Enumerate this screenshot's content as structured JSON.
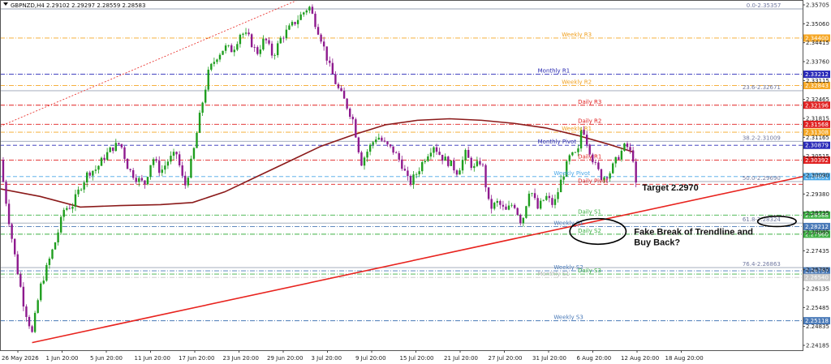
{
  "header": {
    "symbol": "GBPNZD,H4",
    "ohlc": "2.29102 2.29297 2.28559 2.28583"
  },
  "colors": {
    "bull": "#1f9e1f",
    "bear": "#8e1a8e",
    "ma": "#8b1a1a",
    "trend": "#e8231e"
  },
  "chart_data": {
    "type": "line",
    "ylim": [
      2.2415,
      2.3565
    ],
    "y_ticks": [
      "2.35705",
      "2.35060",
      "2.34415",
      "2.33760",
      "2.33115",
      "2.32465",
      "2.31815",
      "2.31165",
      "2.30515",
      "2.30090",
      "2.29380",
      "2.28735",
      "2.28085",
      "2.27435",
      "2.26785",
      "2.26135",
      "2.25485",
      "2.24835",
      "2.24185"
    ],
    "x_ticks": [
      "26 May 2026",
      "1 Jun 20:00",
      "5 Jun 20:00",
      "11 Jun 20:00",
      "17 Jun 20:00",
      "23 Jun 20:00",
      "29 Jun 20:00",
      "3 Jul 20:00",
      "9 Jul 20:00",
      "15 Jul 20:00",
      "21 Jul 20:00",
      "27 Jul 20:00",
      "31 Jul 20:00",
      "6 Aug 20:00",
      "12 Aug 20:00",
      "18 Aug 20:00"
    ],
    "price_path": [
      [
        0,
        2.304
      ],
      [
        0.01,
        2.286
      ],
      [
        0.02,
        2.27
      ],
      [
        0.03,
        2.256
      ],
      [
        0.04,
        2.247
      ],
      [
        0.05,
        2.262
      ],
      [
        0.06,
        2.27
      ],
      [
        0.07,
        2.278
      ],
      [
        0.08,
        2.288
      ],
      [
        0.09,
        2.289
      ],
      [
        0.1,
        2.295
      ],
      [
        0.11,
        2.3
      ],
      [
        0.12,
        2.301
      ],
      [
        0.13,
        2.305
      ],
      [
        0.14,
        2.308
      ],
      [
        0.15,
        2.3095
      ],
      [
        0.16,
        2.301
      ],
      [
        0.17,
        2.298
      ],
      [
        0.18,
        2.296
      ],
      [
        0.19,
        2.305
      ],
      [
        0.2,
        2.3
      ],
      [
        0.21,
        2.304
      ],
      [
        0.22,
        2.306
      ],
      [
        0.23,
        2.295
      ],
      [
        0.24,
        2.305
      ],
      [
        0.25,
        2.32
      ],
      [
        0.26,
        2.333
      ],
      [
        0.27,
        2.338
      ],
      [
        0.28,
        2.341
      ],
      [
        0.29,
        2.34
      ],
      [
        0.3,
        2.346
      ],
      [
        0.31,
        2.344
      ],
      [
        0.32,
        2.339
      ],
      [
        0.33,
        2.344
      ],
      [
        0.34,
        2.338
      ],
      [
        0.35,
        2.344
      ],
      [
        0.36,
        2.347
      ],
      [
        0.37,
        2.35
      ],
      [
        0.38,
        2.353
      ],
      [
        0.385,
        2.3545
      ],
      [
        0.39,
        2.351
      ],
      [
        0.4,
        2.344
      ],
      [
        0.41,
        2.335
      ],
      [
        0.42,
        2.328
      ],
      [
        0.43,
        2.323
      ],
      [
        0.44,
        2.317
      ],
      [
        0.45,
        2.303
      ],
      [
        0.46,
        2.308
      ],
      [
        0.47,
        2.312
      ],
      [
        0.48,
        2.309
      ],
      [
        0.49,
        2.307
      ],
      [
        0.5,
        2.303
      ],
      [
        0.51,
        2.296
      ],
      [
        0.52,
        2.3
      ],
      [
        0.53,
        2.305
      ],
      [
        0.54,
        2.309
      ],
      [
        0.55,
        2.305
      ],
      [
        0.56,
        2.303
      ],
      [
        0.57,
        2.3
      ],
      [
        0.58,
        2.306
      ],
      [
        0.59,
        2.301
      ],
      [
        0.6,
        2.304
      ],
      [
        0.61,
        2.288
      ],
      [
        0.62,
        2.29
      ],
      [
        0.63,
        2.287
      ],
      [
        0.64,
        2.29
      ],
      [
        0.65,
        2.283
      ],
      [
        0.66,
        2.295
      ],
      [
        0.67,
        2.288
      ],
      [
        0.68,
        2.292
      ],
      [
        0.69,
        2.289
      ],
      [
        0.7,
        2.298
      ],
      [
        0.71,
        2.305
      ],
      [
        0.72,
        2.306
      ],
      [
        0.725,
        2.316
      ],
      [
        0.73,
        2.311
      ],
      [
        0.74,
        2.303
      ],
      [
        0.75,
        2.298
      ],
      [
        0.76,
        2.3
      ],
      [
        0.77,
        2.305
      ],
      [
        0.78,
        2.309
      ],
      [
        0.79,
        2.304
      ],
      [
        0.795,
        2.286
      ]
    ],
    "ma_path": [
      [
        0,
        2.2945
      ],
      [
        0.05,
        2.292
      ],
      [
        0.1,
        2.2885
      ],
      [
        0.15,
        2.289
      ],
      [
        0.2,
        2.2893
      ],
      [
        0.24,
        2.29
      ],
      [
        0.28,
        2.2935
      ],
      [
        0.32,
        2.2985
      ],
      [
        0.36,
        2.3035
      ],
      [
        0.4,
        2.3085
      ],
      [
        0.44,
        2.3122
      ],
      [
        0.48,
        2.3155
      ],
      [
        0.52,
        2.317
      ],
      [
        0.56,
        2.3175
      ],
      [
        0.6,
        2.317
      ],
      [
        0.64,
        2.316
      ],
      [
        0.68,
        2.3145
      ],
      [
        0.72,
        2.312
      ],
      [
        0.76,
        2.309
      ],
      [
        0.79,
        2.3065
      ]
    ],
    "trendline": [
      [
        0.04,
        2.244
      ],
      [
        1.0,
        2.2985
      ]
    ],
    "upper_channel": [
      [
        0,
        2.315
      ],
      [
        0.38,
        2.3575
      ]
    ],
    "levels": [
      {
        "name": "fib-0",
        "value": 2.35357,
        "label": "0.0-2.35357",
        "axis": "",
        "color": "#9aa3b5",
        "style": "solid",
        "lx": 0.93,
        "lc": "#7078a0"
      },
      {
        "name": "weekly-r3",
        "value": 2.344,
        "label": "Weekly R3",
        "axis": "2.34400",
        "color": "#f5a623",
        "style": "dashdot",
        "lx": 0.7,
        "lc": "#f0a020"
      },
      {
        "name": "monthly-r1",
        "value": 2.33212,
        "label": "Monthly R1",
        "axis": "2.33212",
        "color": "#2a2ab8",
        "style": "dashdot",
        "lx": 0.67,
        "lc": "#2828b0"
      },
      {
        "name": "weekly-r2",
        "value": 2.32843,
        "label": "Weekly R2",
        "axis": "2.32843",
        "color": "#f5a623",
        "style": "dashdot",
        "lx": 0.7,
        "lc": "#f0a020"
      },
      {
        "name": "fib-236",
        "value": 2.32671,
        "label": "23.6-2.32671",
        "axis": "",
        "color": "#9aa3b5",
        "style": "solid",
        "lx": 0.925,
        "lc": "#7078a0"
      },
      {
        "name": "daily-r3",
        "value": 2.32196,
        "label": "Daily R3",
        "axis": "2.32196",
        "color": "#e02020",
        "style": "dashdot",
        "lx": 0.72,
        "lc": "#e02020"
      },
      {
        "name": "daily-r2",
        "value": 2.31568,
        "label": "Daily R2",
        "axis": "2.31568",
        "color": "#e02020",
        "style": "dashdot",
        "lx": 0.72,
        "lc": "#e02020"
      },
      {
        "name": "weekly-r1",
        "value": 2.31308,
        "label": "Weekly R1",
        "axis": "2.31308",
        "color": "#f5a623",
        "style": "dashdot",
        "lx": 0.7,
        "lc": "#f0a020"
      },
      {
        "name": "fib-382",
        "value": 2.31009,
        "label": "38.2-2.31009",
        "axis": "",
        "color": "#9aa3b5",
        "style": "solid",
        "lx": 0.925,
        "lc": "#7078a0"
      },
      {
        "name": "monthly-pivot",
        "value": 2.30879,
        "label": "Monthly Pivot",
        "axis": "2.30879",
        "color": "#2a2ab8",
        "style": "dashed",
        "lx": 0.67,
        "lc": "#2828b0"
      },
      {
        "name": "daily-r1",
        "value": 2.30392,
        "label": "Daily R1",
        "axis": "2.30392",
        "color": "#e02020",
        "style": "dashdot",
        "lx": 0.72,
        "lc": "#e02020"
      },
      {
        "name": "weekly-pivot",
        "value": 2.29851,
        "label": "Weekly Pivot",
        "axis": "2.29851",
        "color": "#4aa8e8",
        "style": "dashed",
        "lx": 0.69,
        "lc": "#4aa8e8"
      },
      {
        "name": "fib-50",
        "value": 2.2969,
        "label": "50.0-2.29690",
        "axis": "",
        "color": "#9aa3b5",
        "style": "solid",
        "lx": 0.925,
        "lc": "#7078a0"
      },
      {
        "name": "daily-pivot",
        "value": 2.296,
        "label": "Daily Pivot",
        "axis": "",
        "color": "#e02020",
        "style": "dashed",
        "lx": 0.72,
        "lc": "#e02020"
      },
      {
        "name": "daily-s1",
        "value": 2.28588,
        "label": "Daily S1",
        "axis": "2.28588",
        "color": "#3cb043",
        "style": "dashdot",
        "lx": 0.72,
        "lc": "#3cb043"
      },
      {
        "name": "fib-618",
        "value": 2.28324,
        "label": "61.8-2.28324",
        "axis": "",
        "color": "#9aa3b5",
        "style": "solid",
        "lx": 0.925,
        "lc": "#7078a0"
      },
      {
        "name": "weekly-s1",
        "value": 2.28212,
        "label": "Weekly S1",
        "axis": "2.28212",
        "color": "#4a7ab8",
        "style": "dashdot",
        "lx": 0.69,
        "lc": "#4a7ab8"
      },
      {
        "name": "daily-s2",
        "value": 2.2796,
        "label": "Daily S2",
        "axis": "2.27960",
        "color": "#3cb043",
        "style": "dashdot",
        "lx": 0.72,
        "lc": "#3cb043"
      },
      {
        "name": "fib-786",
        "value": 2.26863,
        "label": "76.4-2.26863",
        "axis": "",
        "color": "#9aa3b5",
        "style": "solid",
        "lx": 0.925,
        "lc": "#7078a0"
      },
      {
        "name": "weekly-s2",
        "value": 2.26757,
        "label": "Weekly S2",
        "axis": "2.26757",
        "color": "#4a7ab8",
        "style": "dashdot",
        "lx": 0.69,
        "lc": "#4a7ab8"
      },
      {
        "name": "daily-s3",
        "value": 2.2665,
        "label": "Daily S3",
        "axis": "",
        "color": "#3cb043",
        "style": "dashdot",
        "lx": 0.72,
        "lc": "#3cb043"
      },
      {
        "name": "monthly-s1",
        "value": 2.2654,
        "label": "Monthly S1",
        "axis": "2.26540",
        "color": "#c8c8c8",
        "style": "dashdot",
        "lx": 0.67,
        "lc": "#bbbbbb"
      },
      {
        "name": "weekly-s3",
        "value": 2.25118,
        "label": "Weekly S3",
        "axis": "2.25118",
        "color": "#4a7ab8",
        "style": "dashdot",
        "lx": 0.69,
        "lc": "#4a7ab8"
      }
    ],
    "annotations": [
      {
        "name": "target-annotation",
        "text": "Target 2.2970",
        "x": 0.8,
        "y": 2.294
      },
      {
        "name": "fake-break-line1",
        "text": "Fake Break of Trendline and",
        "x": 0.79,
        "y": 2.2795
      },
      {
        "name": "fake-break-line2",
        "text": "Buy Back?",
        "x": 0.79,
        "y": 2.276
      }
    ],
    "ellipses": [
      {
        "name": "ellipse-break",
        "cx": 0.745,
        "cy": 2.2805,
        "rx": 0.035,
        "ry": 0.0042
      },
      {
        "name": "ellipse-axis",
        "cx": 0.968,
        "cy": 2.2838,
        "rx": 0.024,
        "ry": 0.0017
      }
    ]
  }
}
